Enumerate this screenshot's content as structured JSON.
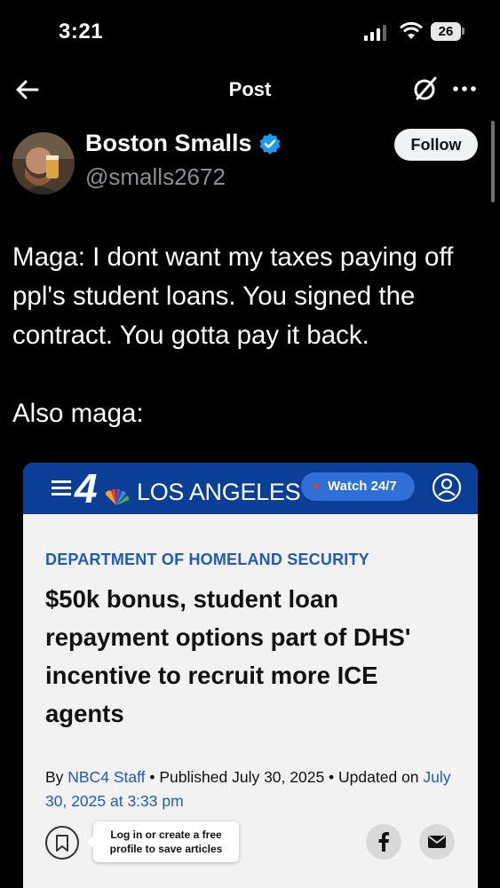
{
  "status_bar": {
    "time": "3:21",
    "battery": "26"
  },
  "nav": {
    "title": "Post",
    "icons": [
      "back-arrow-icon",
      "grok-icon",
      "more-icon"
    ]
  },
  "author": {
    "name": "Boston Smalls",
    "handle": "@smalls2672",
    "follow_label": "Follow",
    "verified_color": "#1d9bf0"
  },
  "post": {
    "text": "Maga: I dont want my taxes paying off ppl's student loans. You signed the contract. You gotta pay it back.\n\nAlso maga:"
  },
  "card": {
    "station": "LOS ANGELES",
    "logo_number": "4",
    "watch_label": "Watch 24/7",
    "kicker": "DEPARTMENT OF HOMELAND SECURITY",
    "headline": "$50k bonus, student loan repayment options part of DHS' incentive to recruit more ICE agents",
    "byline_prefix": "By ",
    "byline_author": "NBC4 Staff",
    "byline_rest": " • Published July 30, 2025 • Updated on ",
    "byline_updated": "July 30, 2025 at 3:33 pm",
    "tooltip_line1": "Log in or create a free",
    "tooltip_line2": "profile to save articles",
    "header_color": "#0b3f97",
    "accent_color": "#1f5bb8"
  }
}
